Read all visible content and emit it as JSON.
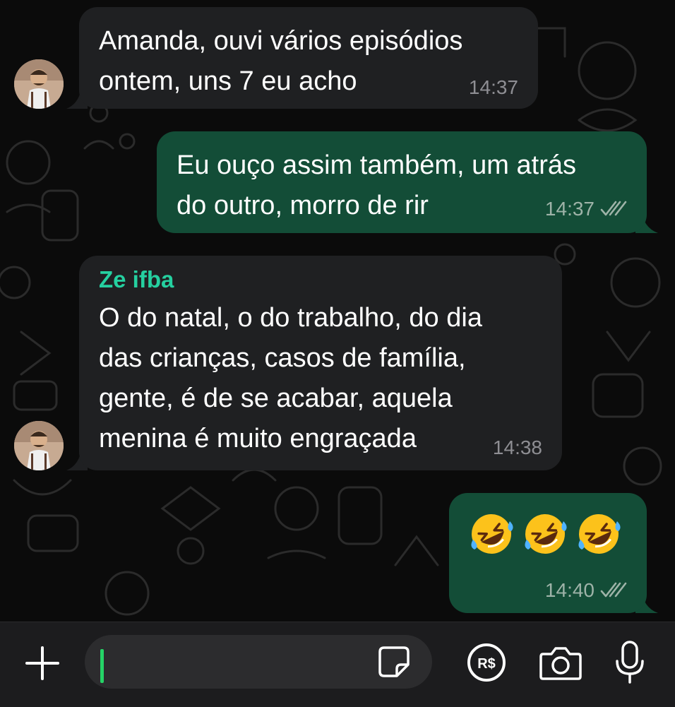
{
  "messages": [
    {
      "direction": "incoming",
      "text": "Amanda, ouvi vários episódios\nontem, uns 7 eu acho",
      "time": "14:37"
    },
    {
      "direction": "outgoing",
      "text": "Eu ouço assim também, um atrás\ndo outro, morro de rir",
      "time": "14:37",
      "status": "read"
    },
    {
      "direction": "incoming",
      "sender": "Ze ifba",
      "text": "O do natal, o do trabalho, do dia\ndas crianças, casos de família,\ngente, é de se acabar, aquela\nmenina é muito engraçada",
      "time": "14:38"
    },
    {
      "direction": "outgoing",
      "emojis": [
        "rolling-on-floor-laughing",
        "rolling-on-floor-laughing",
        "rolling-on-floor-laughing"
      ],
      "time": "14:40",
      "status": "read"
    }
  ],
  "composer": {
    "message_input_value": "",
    "icons": [
      "plus-icon",
      "sticker-icon",
      "pix-payment-icon",
      "camera-icon",
      "microphone-icon"
    ]
  },
  "colors": {
    "incoming_bubble": "#1f2022",
    "outgoing_bubble": "#134d37",
    "sender_name": "#25d0a0",
    "caret": "#25d366"
  }
}
